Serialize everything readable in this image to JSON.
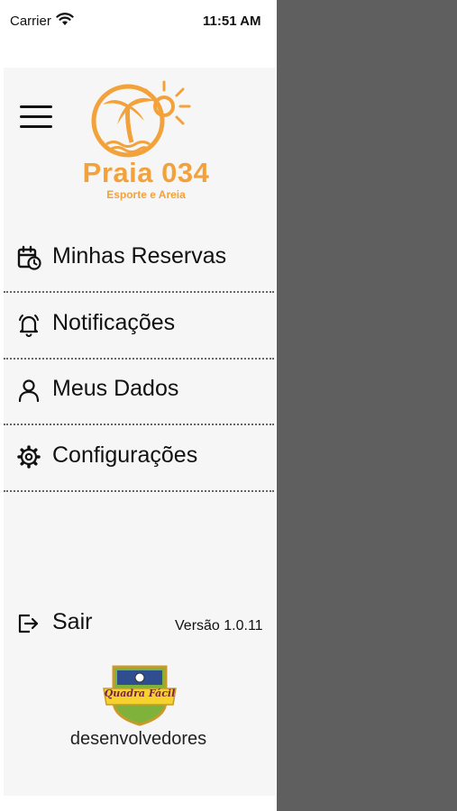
{
  "status_bar": {
    "carrier": "Carrier",
    "time": "11:51 AM"
  },
  "brand": {
    "name": "Praia 034",
    "tagline": "Esporte e Areia",
    "color": "#f3a23b"
  },
  "menu": [
    {
      "label": "Minhas Reservas",
      "icon": "calendar-clock-icon"
    },
    {
      "label": "Notificações",
      "icon": "bell-icon"
    },
    {
      "label": "Meus Dados",
      "icon": "user-icon"
    },
    {
      "label": "Configurações",
      "icon": "gear-icon"
    }
  ],
  "footer": {
    "logout_label": "Sair",
    "version": "Versão 1.0.11",
    "partner_logo_text": "Quadra Fácil",
    "developers_label": "desenvolvedores"
  },
  "colors": {
    "overlay": "#5f5f5f",
    "drawer_bg": "#f6f6f6"
  }
}
